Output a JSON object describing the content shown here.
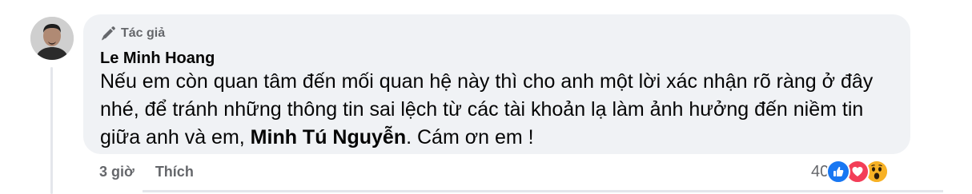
{
  "comment": {
    "badge": "Tác giả",
    "author": "Le Minh Hoang",
    "text_before": "Nếu em còn quan tâm đến mối quan hệ này thì cho anh một lời xác nhận rõ ràng ở đây nhé, để tránh những thông tin sai lệch từ các tài khoản lạ làm ảnh hưởng đến niềm tin giữa anh và em, ",
    "mention": "Minh Tú Nguyễn",
    "text_after": ". Cám ơn em !"
  },
  "actions": {
    "time": "3 giờ",
    "like_label": "Thích"
  },
  "reactions": {
    "count": "40",
    "types": [
      "like-icon",
      "love-icon",
      "wow-icon"
    ],
    "colors": {
      "like": "#1877f2",
      "love": "#f33e58",
      "wow": "#f7b125"
    }
  },
  "theme": {
    "bubble_bg": "#f0f2f5",
    "secondary_text": "#65676b",
    "primary_text": "#050505"
  }
}
